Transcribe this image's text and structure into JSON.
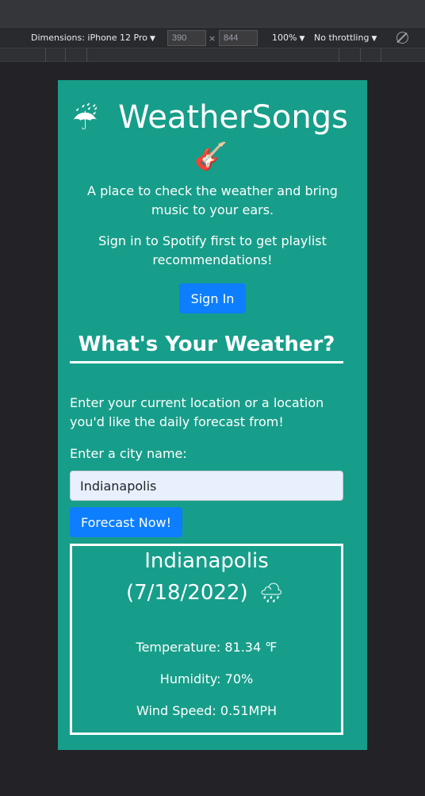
{
  "devtools": {
    "device_label": "Dimensions: iPhone 12 Pro",
    "width": "390",
    "height": "844",
    "times": "×",
    "zoom": "100%",
    "throttling": "No throttling",
    "caret": "▼"
  },
  "header": {
    "umbrella_icon": "☔",
    "title": "WeatherSongs",
    "guitar_icon": "🎸",
    "tagline": "A place to check the weather and bring music to your ears.",
    "signin_note": "Sign in to Spotify first to get playlist recommendations!",
    "signin_label": "Sign In"
  },
  "search": {
    "section_title": "What's Your Weather?",
    "instructions": "Enter your current location or a location you'd like the daily forecast from!",
    "city_label": "Enter a city name:",
    "city_value": "Indianapolis",
    "button_label": "Forecast Now!"
  },
  "weather": {
    "city": "Indianapolis",
    "date": "(7/18/2022)",
    "icon": "🌧",
    "temperature": "Temperature: 81.34 ℉",
    "humidity": "Humidity: 70%",
    "wind": "Wind Speed: 0.51MPH"
  },
  "colors": {
    "page_bg": "#179e8a",
    "button_bg": "#0d7efd",
    "input_bg": "#e8f0fe"
  }
}
